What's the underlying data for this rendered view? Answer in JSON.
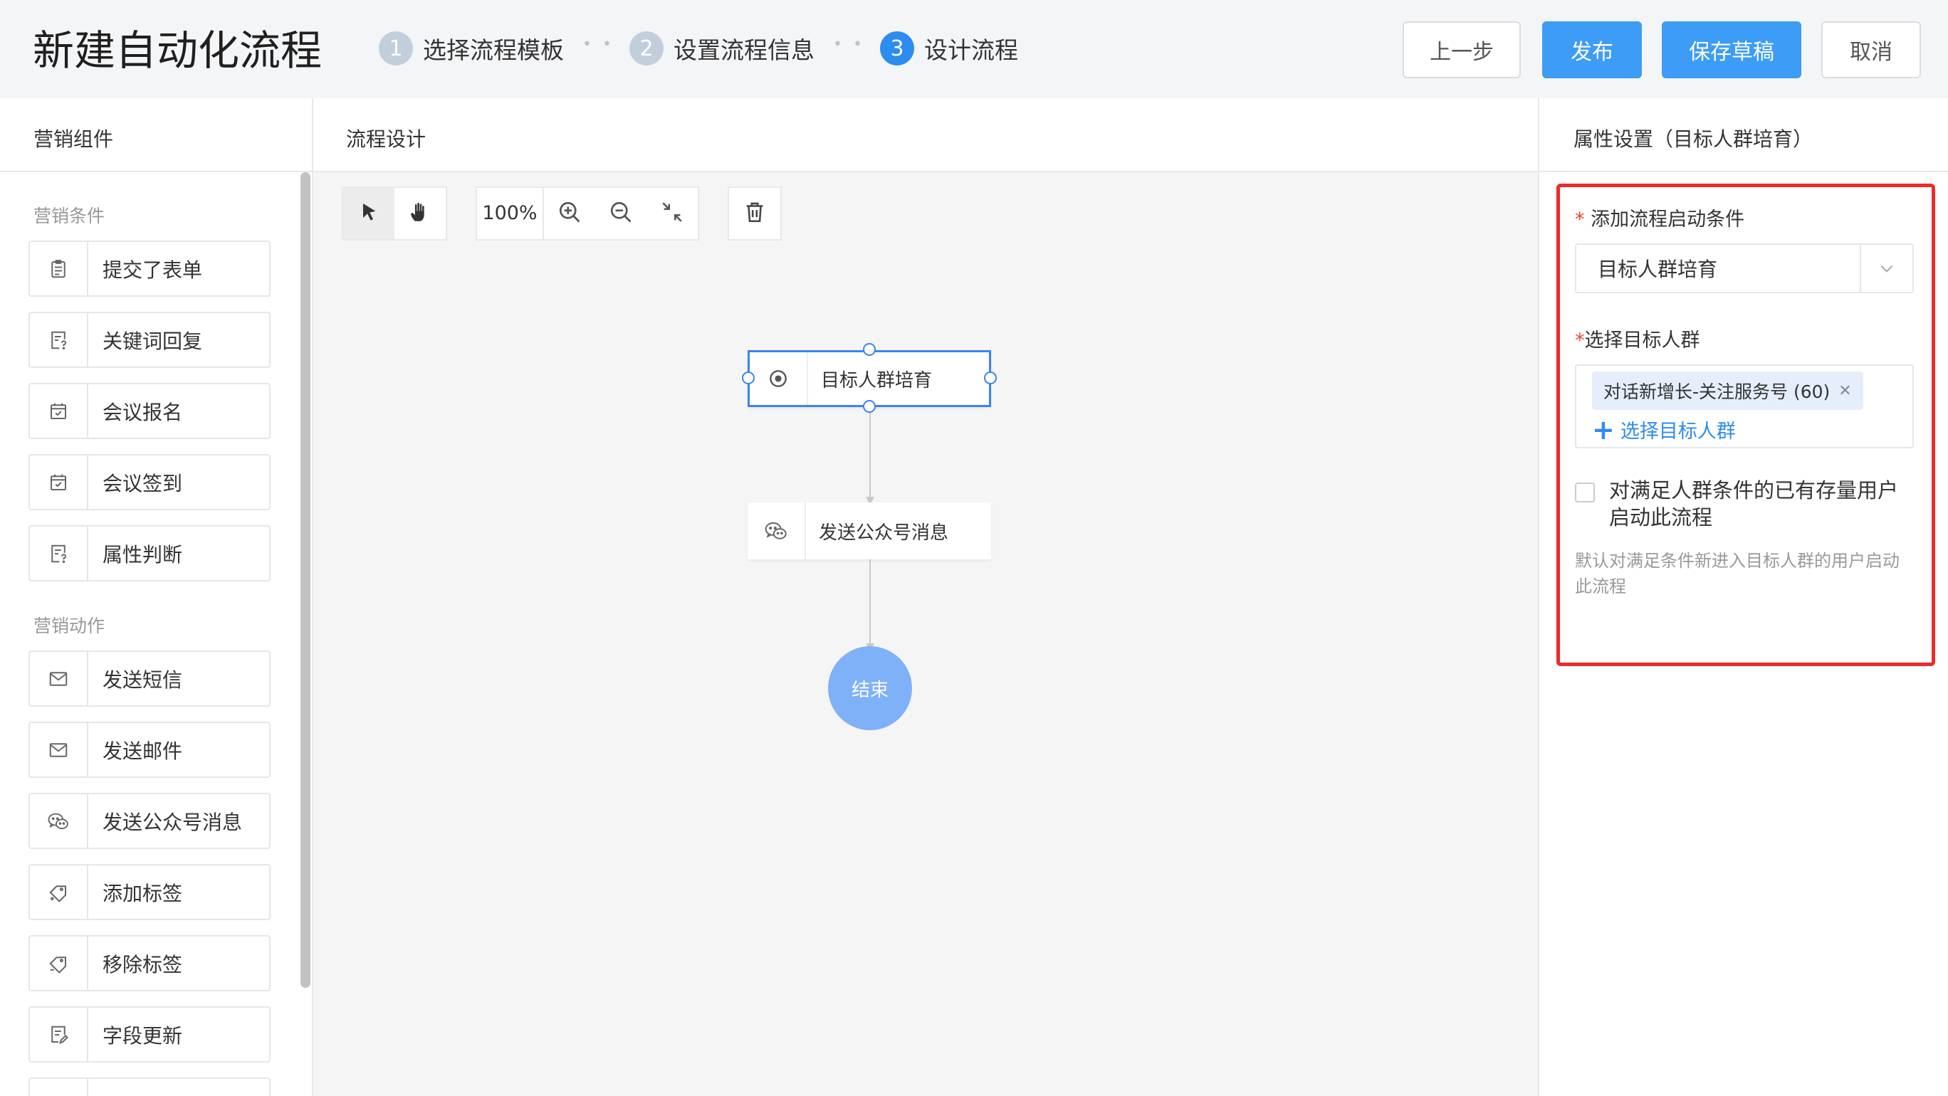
{
  "header": {
    "title": "新建自动化流程",
    "steps": [
      {
        "num": "1",
        "label": "选择流程模板"
      },
      {
        "num": "2",
        "label": "设置流程信息"
      },
      {
        "num": "3",
        "label": "设计流程"
      }
    ],
    "buttons": {
      "prev": "上一步",
      "publish": "发布",
      "save_draft": "保存草稿",
      "cancel": "取消"
    }
  },
  "left_panel": {
    "title": "营销组件",
    "groups": [
      {
        "title": "营销条件",
        "items": [
          {
            "label": "提交了表单",
            "icon": "form-icon"
          },
          {
            "label": "关键词回复",
            "icon": "keyword-reply-icon"
          },
          {
            "label": "会议报名",
            "icon": "calendar-check-icon"
          },
          {
            "label": "会议签到",
            "icon": "calendar-check-icon"
          },
          {
            "label": "属性判断",
            "icon": "attribute-icon"
          }
        ]
      },
      {
        "title": "营销动作",
        "items": [
          {
            "label": "发送短信",
            "icon": "mail-icon"
          },
          {
            "label": "发送邮件",
            "icon": "mail-icon"
          },
          {
            "label": "发送公众号消息",
            "icon": "wechat-icon"
          },
          {
            "label": "添加标签",
            "icon": "tag-add-icon"
          },
          {
            "label": "移除标签",
            "icon": "tag-remove-icon"
          },
          {
            "label": "字段更新",
            "icon": "field-update-icon"
          }
        ]
      }
    ]
  },
  "canvas": {
    "title": "流程设计",
    "zoom": "100%",
    "nodes": {
      "start": "目标人群培育",
      "action": "发送公众号消息",
      "end": "结束"
    }
  },
  "right_panel": {
    "title": "属性设置（目标人群培育）",
    "trigger": {
      "required_mark": "*",
      "label": "添加流程启动条件",
      "value": "目标人群培育"
    },
    "audience": {
      "required_mark": "*",
      "label": "选择目标人群",
      "tag": "对话新增长-关注服务号 (60)",
      "add_link": "选择目标人群"
    },
    "existing_users": {
      "label": "对满足人群条件的已有存量用户启动此流程",
      "checked": false,
      "hint": "默认对满足条件新进入目标人群的用户启动此流程"
    }
  },
  "colors": {
    "primary": "#3d9cf5",
    "step_active": "#2d8cf0",
    "highlight_border": "#ee2a2a",
    "end_node": "#7fb1f9"
  }
}
